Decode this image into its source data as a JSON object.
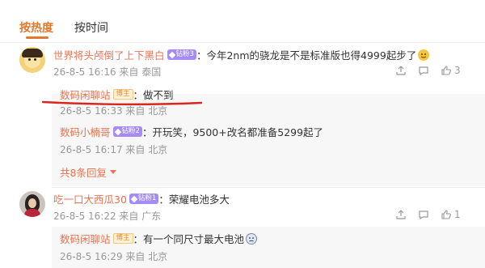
{
  "sort_tabs": [
    {
      "label": "按热度",
      "active": true
    },
    {
      "label": "按时间",
      "active": false
    }
  ],
  "comments": [
    {
      "user": "世界将头颅倒了上下黑白",
      "badge": "钻粉3",
      "colon": "：",
      "text": "今年2nm的骁龙是不是标准版也得4999起步了",
      "meta": "26-8-5 16:16 来自 泰国",
      "likes": "3",
      "replies": [
        {
          "user": "数码闲聊站",
          "author_badge": "博主",
          "colon": "：",
          "text": "做不到",
          "meta": "26-8-5 16:33 来自 北京"
        },
        {
          "user": "数码小楠哥",
          "badge": "钻粉2",
          "colon": "：",
          "text": "开玩笑，9500+改名都准备5299起了",
          "meta": "26-8-5 16:17 来自 北京"
        }
      ],
      "more_replies": "共8条回复"
    },
    {
      "user": "吃一口大西瓜30",
      "badge": "钻粉1",
      "colon": "：",
      "text": "荣耀电池多大",
      "meta": "26-8-5 16:22 来自 广东",
      "likes": "1",
      "replies": [
        {
          "user": "数码闲聊站",
          "author_badge": "博主",
          "colon": "：",
          "text": "有一个同尺寸最大电池",
          "meta": "26-8-5 16:29 来自 北京"
        }
      ]
    }
  ],
  "icons": [
    "share-icon",
    "comment-icon",
    "like-icon",
    "emoji-icon"
  ],
  "colors": {
    "accent": "#e0792b",
    "username": "#eb7350",
    "fan_badge": "#a58bf5",
    "highlight_mark": "#d9261c"
  }
}
